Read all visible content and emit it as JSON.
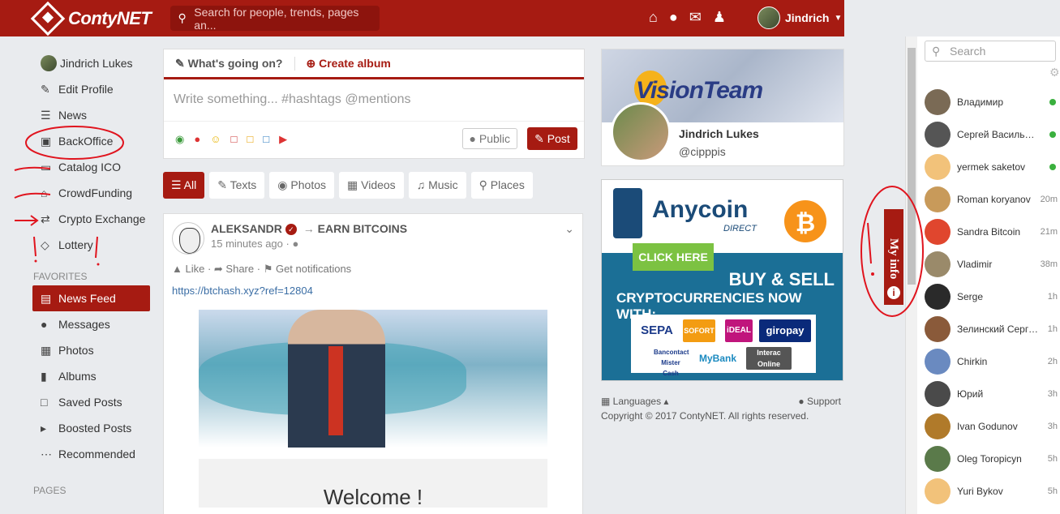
{
  "header": {
    "brand": "ContyNET",
    "search_placeholder": "Search for people, trends, pages an...",
    "user_name": "Jindrich"
  },
  "sidebar": {
    "items": [
      {
        "label": "Jindrich Lukes",
        "icon": "avatar"
      },
      {
        "label": "Edit Profile",
        "icon": "pencil-icon"
      },
      {
        "label": "News",
        "icon": "list-icon"
      },
      {
        "label": "BackOffice",
        "icon": "briefcase-icon"
      },
      {
        "label": "Catalog ICO",
        "icon": "credit-card-icon"
      },
      {
        "label": "CrowdFunding",
        "icon": "bank-icon"
      },
      {
        "label": "Crypto Exchange",
        "icon": "exchange-icon"
      },
      {
        "label": "Lottery",
        "icon": "diamond-icon"
      }
    ],
    "favorites_title": "FAVORITES",
    "favorites": [
      {
        "label": "News Feed",
        "icon": "newspaper-icon",
        "active": true
      },
      {
        "label": "Messages",
        "icon": "chat-icon"
      },
      {
        "label": "Photos",
        "icon": "image-icon"
      },
      {
        "label": "Albums",
        "icon": "folder-icon"
      },
      {
        "label": "Saved Posts",
        "icon": "file-icon"
      },
      {
        "label": "Boosted Posts",
        "icon": "megaphone-icon"
      },
      {
        "label": "Recommended",
        "icon": "ellipsis-icon"
      }
    ],
    "pages_title": "PAGES"
  },
  "composer": {
    "tab_status": "What's going on?",
    "tab_album": "Create album",
    "placeholder": "Write something... #hashtags @mentions",
    "privacy": "Public",
    "post_label": "Post"
  },
  "filters": [
    {
      "label": "All",
      "active": true
    },
    {
      "label": "Texts"
    },
    {
      "label": "Photos"
    },
    {
      "label": "Videos"
    },
    {
      "label": "Music"
    },
    {
      "label": "Places"
    }
  ],
  "post": {
    "author": "ALEKSANDR",
    "target": "EARN BITCOINS",
    "time": "15 minutes ago",
    "like": "Like",
    "share": "Share",
    "notify": "Get notifications",
    "link": "https://btchash.xyz?ref=12804",
    "welcome": "Welcome !"
  },
  "profile_card": {
    "cover_text": "VisionTeam",
    "name": "Jindrich Lukes",
    "handle": "@cipppis"
  },
  "ad": {
    "brand": "Anycoin",
    "sub": "DIRECT",
    "btc_symbol": "₿",
    "cta": "CLICK HERE",
    "headline": "BUY & SELL",
    "subheadline": "CRYPTOCURRENCIES NOW WITH:",
    "payments": [
      "SEPA",
      "SOFORT",
      "iDEAL",
      "giropay",
      "Bancontact Mister Cash",
      "MyBank",
      "Interac Online"
    ]
  },
  "footer": {
    "languages": "Languages",
    "support": "Support",
    "copyright": "Copyright © 2017 ContyNET. All rights reserved."
  },
  "myinfo": {
    "label": "My info"
  },
  "chat": {
    "search_placeholder": "Search",
    "contacts": [
      {
        "name": "Владимир",
        "status": "online",
        "color": "#7a6a55"
      },
      {
        "name": "Сергей Васильев...",
        "status": "online",
        "color": "#555555"
      },
      {
        "name": "yermek saketov",
        "status": "online",
        "color": "#f2c27a"
      },
      {
        "name": "Roman koryanov",
        "time": "20m",
        "color": "#c89a5a"
      },
      {
        "name": "Sandra Bitcoin",
        "time": "21m",
        "color": "#e0462e"
      },
      {
        "name": "Vladimir",
        "time": "38m",
        "color": "#9a8a6a"
      },
      {
        "name": "Serge",
        "time": "1h",
        "color": "#2a2a2a"
      },
      {
        "name": "Зелинский Сергей",
        "time": "1h",
        "color": "#8a5a3a"
      },
      {
        "name": "Chirkin",
        "time": "2h",
        "color": "#6a8ac0"
      },
      {
        "name": "Юрий",
        "time": "3h",
        "color": "#4a4a4a"
      },
      {
        "name": "Ivan Godunov",
        "time": "3h",
        "color": "#b07a2a"
      },
      {
        "name": "Oleg Toropicyn",
        "time": "5h",
        "color": "#5a7a4a"
      },
      {
        "name": "Yuri Bykov",
        "time": "5h",
        "color": "#f2c27a"
      }
    ]
  }
}
